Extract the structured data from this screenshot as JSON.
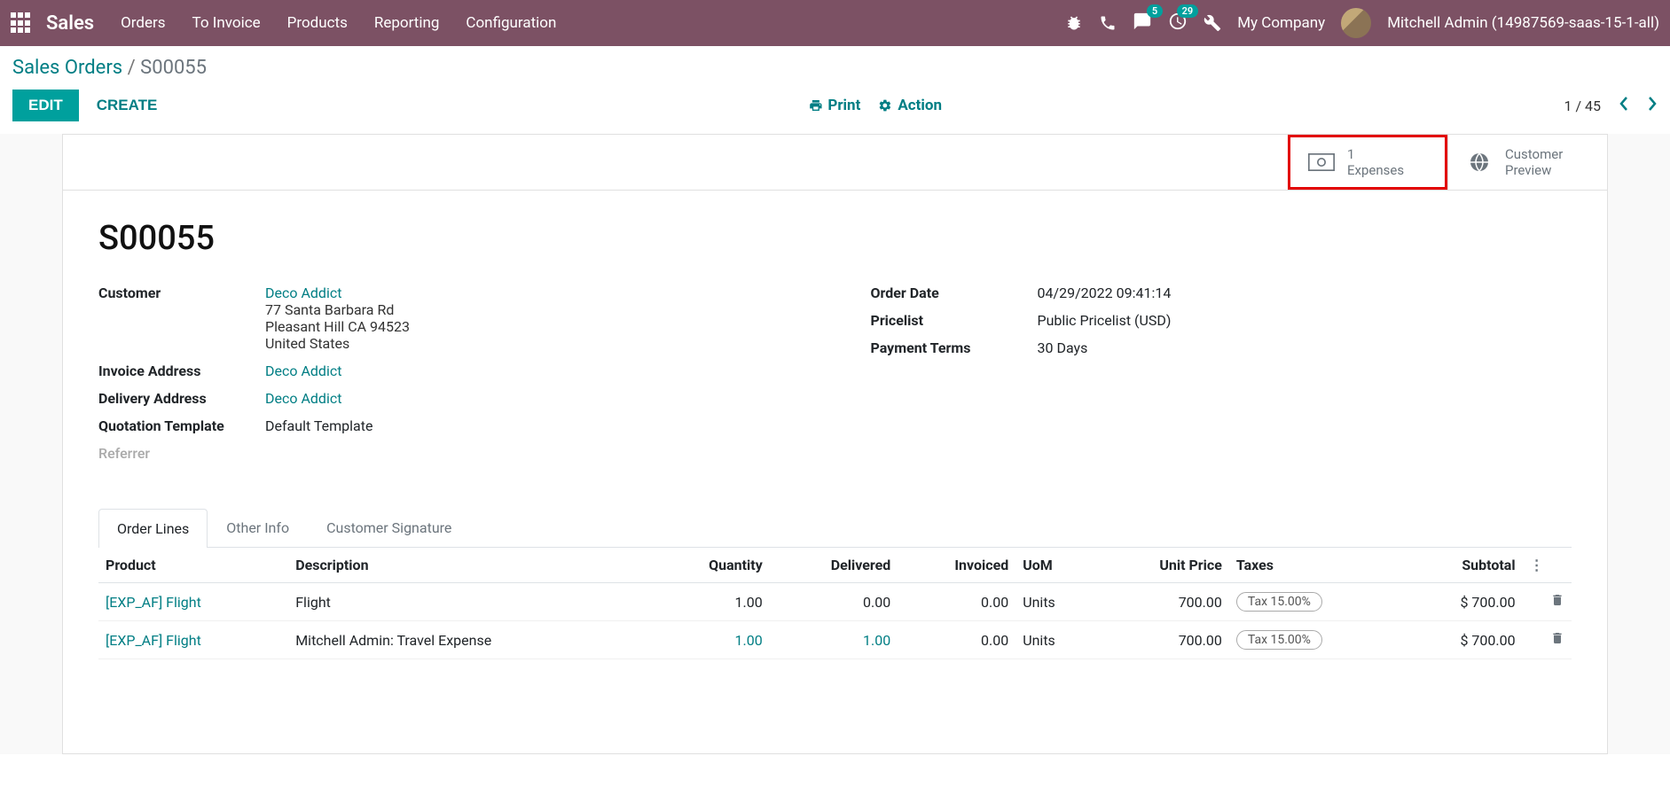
{
  "topnav": {
    "brand": "Sales",
    "links": [
      "Orders",
      "To Invoice",
      "Products",
      "Reporting",
      "Configuration"
    ],
    "messaging_count": "5",
    "activity_count": "29",
    "company": "My Company",
    "user": "Mitchell Admin (14987569-saas-15-1-all)"
  },
  "breadcrumb": {
    "root": "Sales Orders",
    "current": "S00055"
  },
  "buttons": {
    "edit": "EDIT",
    "create": "CREATE",
    "print": "Print",
    "action": "Action"
  },
  "pager": {
    "position": "1 / 45"
  },
  "stat_buttons": {
    "expenses_count": "1",
    "expenses_label": "Expenses",
    "preview_line1": "Customer",
    "preview_line2": "Preview"
  },
  "order": {
    "name": "S00055",
    "customer_label": "Customer",
    "customer_name": "Deco Addict",
    "customer_addr1": "77 Santa Barbara Rd",
    "customer_addr2": "Pleasant Hill CA 94523",
    "customer_addr3": "United States",
    "invoice_address_label": "Invoice Address",
    "invoice_address": "Deco Addict",
    "delivery_address_label": "Delivery Address",
    "delivery_address": "Deco Addict",
    "quotation_template_label": "Quotation Template",
    "quotation_template": "Default Template",
    "referrer_label": "Referrer",
    "order_date_label": "Order Date",
    "order_date": "04/29/2022 09:41:14",
    "pricelist_label": "Pricelist",
    "pricelist": "Public Pricelist (USD)",
    "payment_terms_label": "Payment Terms",
    "payment_terms": "30 Days"
  },
  "tabs": [
    "Order Lines",
    "Other Info",
    "Customer Signature"
  ],
  "table": {
    "headers": {
      "product": "Product",
      "description": "Description",
      "quantity": "Quantity",
      "delivered": "Delivered",
      "invoiced": "Invoiced",
      "uom": "UoM",
      "unit_price": "Unit Price",
      "taxes": "Taxes",
      "subtotal": "Subtotal"
    },
    "rows": [
      {
        "product": "[EXP_AF] Flight",
        "description": "Flight",
        "quantity": "1.00",
        "delivered": "0.00",
        "invoiced": "0.00",
        "uom": "Units",
        "unit_price": "700.00",
        "tax": "Tax 15.00%",
        "subtotal": "$ 700.00",
        "delivered_link": false
      },
      {
        "product": "[EXP_AF] Flight",
        "description": "Mitchell Admin: Travel Expense",
        "quantity": "1.00",
        "delivered": "1.00",
        "invoiced": "0.00",
        "uom": "Units",
        "unit_price": "700.00",
        "tax": "Tax 15.00%",
        "subtotal": "$ 700.00",
        "delivered_link": true
      }
    ]
  }
}
